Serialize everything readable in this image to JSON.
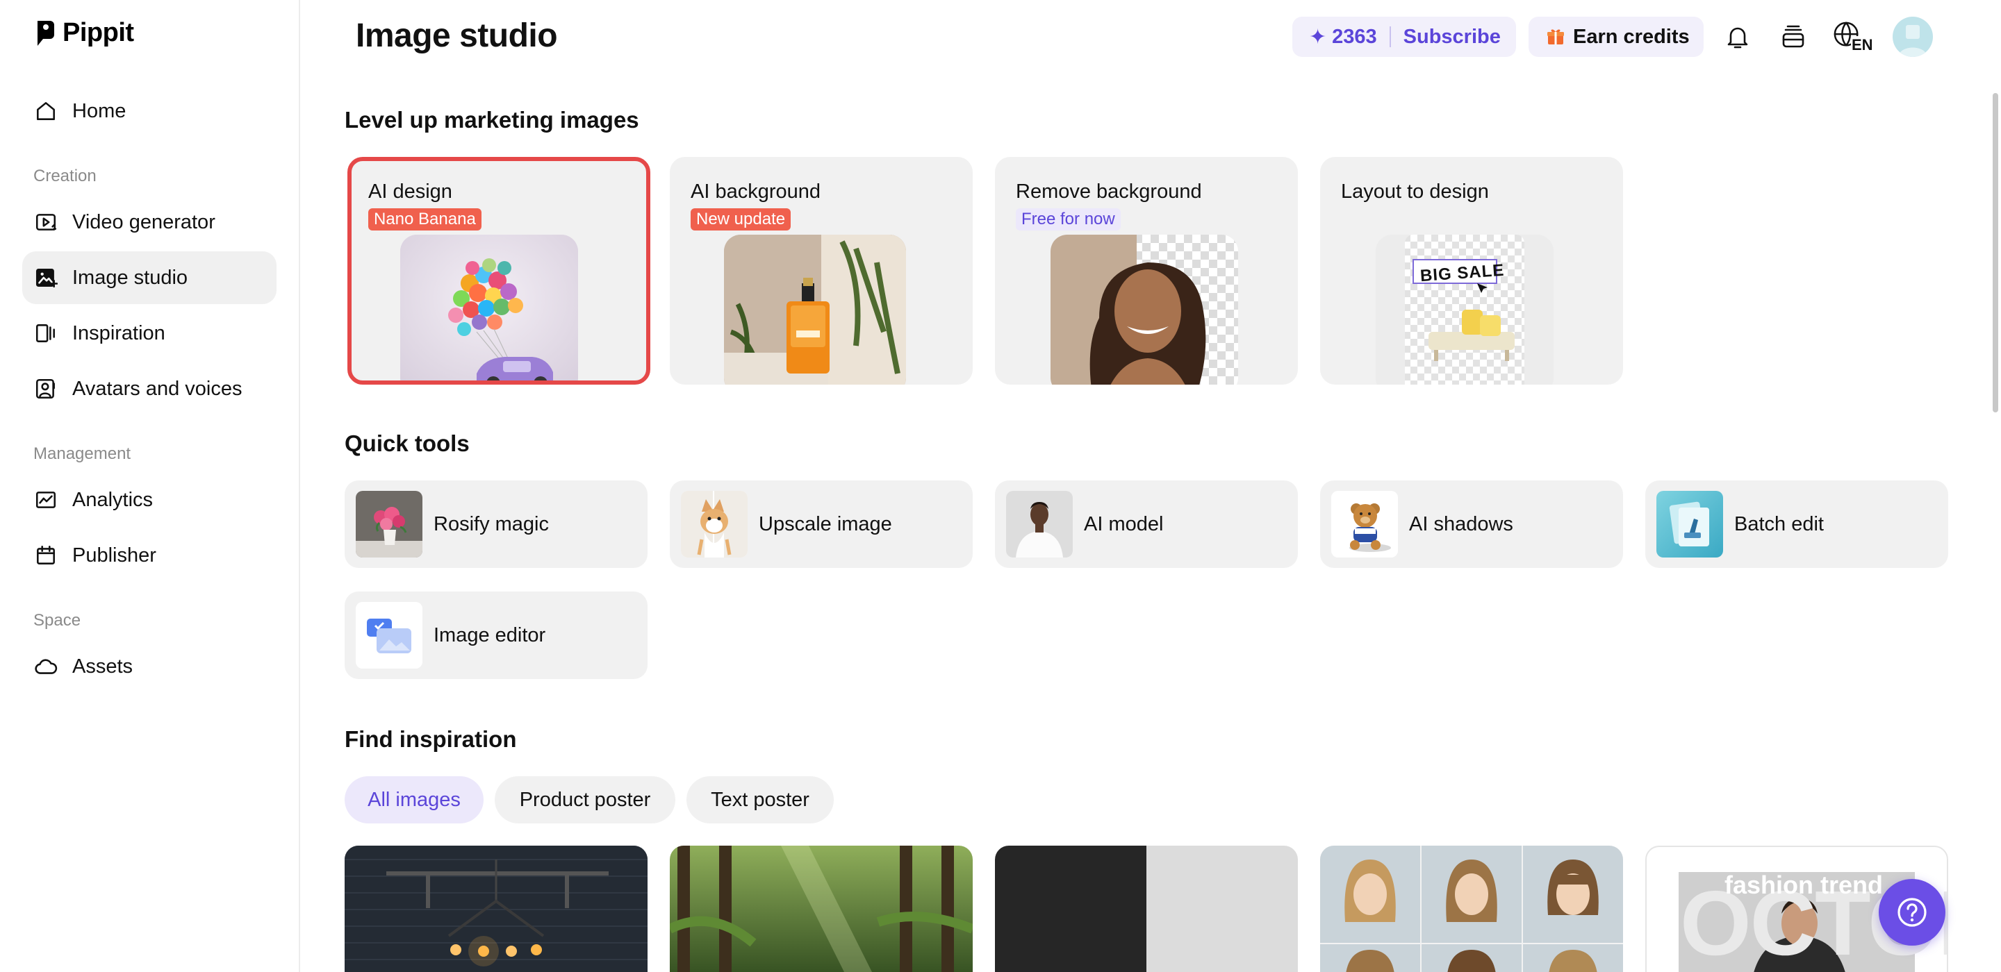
{
  "app": {
    "name": "Pippit"
  },
  "sidebar": {
    "items": [
      {
        "label": "Home",
        "icon": "home-icon"
      },
      {
        "label": "Video generator",
        "icon": "video-generator-icon"
      },
      {
        "label": "Image studio",
        "icon": "image-studio-icon",
        "active": true
      },
      {
        "label": "Inspiration",
        "icon": "inspiration-icon"
      },
      {
        "label": "Avatars and voices",
        "icon": "avatar-voice-icon"
      },
      {
        "label": "Analytics",
        "icon": "analytics-icon"
      },
      {
        "label": "Publisher",
        "icon": "calendar-icon"
      },
      {
        "label": "Assets",
        "icon": "cloud-icon"
      }
    ],
    "sections": {
      "creation": "Creation",
      "management": "Management",
      "space": "Space"
    }
  },
  "header": {
    "title": "Image studio",
    "credits": "2363",
    "subscribe": "Subscribe",
    "earn_credits": "Earn credits",
    "language": "EN",
    "icons": [
      "bell-icon",
      "stack-icon",
      "globe-icon",
      "avatar"
    ]
  },
  "marketing": {
    "title": "Level up marketing images",
    "cards": [
      {
        "title": "AI design",
        "badge": "Nano Banana",
        "badge_style": "red",
        "selected": true
      },
      {
        "title": "AI background",
        "badge": "New update",
        "badge_style": "red"
      },
      {
        "title": "Remove background",
        "badge": "Free for now",
        "badge_style": "purple"
      },
      {
        "title": "Layout to design",
        "badge": "",
        "poster_text": "BIG SALE"
      }
    ]
  },
  "quick_tools": {
    "title": "Quick tools",
    "items": [
      {
        "label": "Rosify magic"
      },
      {
        "label": "Upscale image"
      },
      {
        "label": "AI model"
      },
      {
        "label": "AI shadows"
      },
      {
        "label": "Batch edit"
      },
      {
        "label": "Image editor"
      }
    ]
  },
  "inspiration": {
    "title": "Find inspiration",
    "filters": [
      {
        "label": "All images",
        "active": true
      },
      {
        "label": "Product poster"
      },
      {
        "label": "Text poster"
      }
    ],
    "poster_text": "fashion trend",
    "poster_bg_text": "OCTOBER"
  },
  "colors": {
    "accent": "#5b45d9",
    "badge_red": "#f0604d",
    "selected_border": "#e54848"
  }
}
